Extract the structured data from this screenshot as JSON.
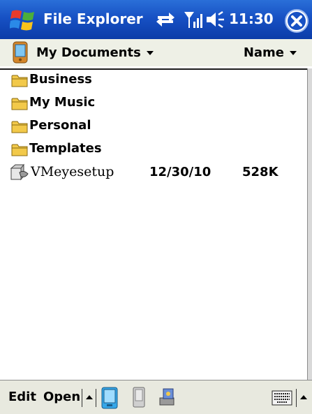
{
  "titlebar": {
    "app_title": "File Explorer",
    "clock": "11:30",
    "icons": [
      "windows-start-icon",
      "sync-icon",
      "signal-icon",
      "volume-icon",
      "close-icon"
    ]
  },
  "toolbar": {
    "location": "My Documents",
    "sort_by": "Name"
  },
  "items": [
    {
      "type": "folder",
      "name": "Business"
    },
    {
      "type": "folder",
      "name": "My Music"
    },
    {
      "type": "folder",
      "name": "Personal"
    },
    {
      "type": "folder",
      "name": "Templates"
    },
    {
      "type": "file",
      "name": "VMeyesetup",
      "date": "12/30/10",
      "size": "528K"
    }
  ],
  "bottombar": {
    "menu_edit": "Edit",
    "menu_open": "Open",
    "icons": [
      "device-icon",
      "storage-card-icon",
      "network-share-icon",
      "keyboard-icon"
    ]
  },
  "colors": {
    "title_bar": "#1751c4",
    "toolbar_bg": "#eef0e6",
    "folder": "#f2c94a"
  }
}
